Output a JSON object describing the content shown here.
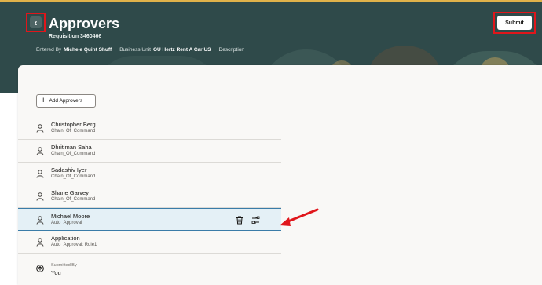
{
  "header": {
    "title": "Approvers",
    "subtitle": "Requisition 3460466",
    "entered_by_label": "Entered By",
    "entered_by_value": "Michele Quint Shuff",
    "business_unit_label": "Business Unit",
    "business_unit_value": "OU Hertz Rent A Car US",
    "description_label": "Description",
    "back_icon": "chevron-left-icon",
    "submit_label": "Submit"
  },
  "toolbar": {
    "add_label": "Add Approvers",
    "add_icon": "plus-icon"
  },
  "approvers": [
    {
      "name": "Christopher Berg",
      "role": "Chain_Of_Command"
    },
    {
      "name": "Dhritiman Saha",
      "role": "Chain_Of_Command"
    },
    {
      "name": "Sadashiv Iyer",
      "role": "Chain_Of_Command"
    },
    {
      "name": "Shane Garvey",
      "role": "Chain_Of_Command"
    },
    {
      "name": "Michael Moore",
      "role": "Auto_Approval",
      "selected": true
    },
    {
      "name": "Application",
      "role": "Auto_Approval: Rule1"
    }
  ],
  "submitted": {
    "label": "Submitted By",
    "value": "You"
  },
  "colors": {
    "header_bg": "#2f4a4a",
    "highlight_red": "#e0161b",
    "selected_row": "#e4f0f6",
    "selected_border": "#3a7ca8"
  }
}
